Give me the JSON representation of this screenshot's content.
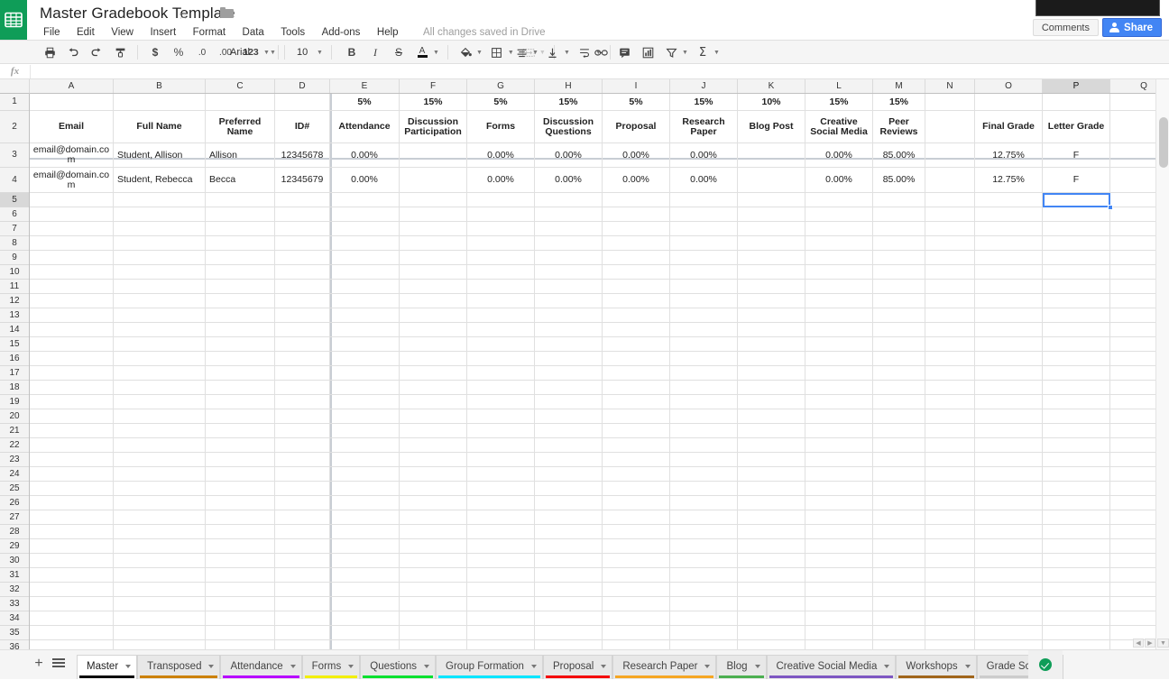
{
  "app": {
    "logo_icon": "sheets-grid-icon",
    "title": "Master Gradebook Template",
    "star_icon": "star-outline-icon",
    "folder_icon": "folder-icon",
    "save_status": "All changes saved in Drive",
    "accent_color": "#0f9d58",
    "share_color": "#4285f4"
  },
  "menu": {
    "items": [
      {
        "label": "File"
      },
      {
        "label": "Edit"
      },
      {
        "label": "View"
      },
      {
        "label": "Insert"
      },
      {
        "label": "Format"
      },
      {
        "label": "Data"
      },
      {
        "label": "Tools"
      },
      {
        "label": "Add-ons"
      },
      {
        "label": "Help"
      }
    ]
  },
  "header_actions": {
    "comments_label": "Comments",
    "share_label": "Share",
    "share_icon": "person-add-icon"
  },
  "toolbar": {
    "print_icon": "print-icon",
    "undo_icon": "undo-arrow-icon",
    "redo_icon": "redo-arrow-icon",
    "paint_format_icon": "paint-format-icon",
    "currency_icon": "$",
    "percent_icon": "%",
    "decrease_decimal_icon": ".0",
    "increase_decimal_icon": ".00",
    "more_formats_label": "123",
    "font_family": "Arial",
    "font_size": "10",
    "bold_icon": "B",
    "italic_icon": "I",
    "strikethrough_icon": "S",
    "text_color_icon": "A",
    "fill_color_icon": "fill-bucket-icon",
    "borders_icon": "borders-icon",
    "merge_cells_icon": "merge-cells-icon",
    "horizontal_align_icon": "horizontal-align-icon",
    "vertical_align_icon": "vertical-align-icon",
    "text_wrap_icon": "text-wrap-icon",
    "insert_link_icon": "link-icon",
    "insert_comment_icon": "comment-icon",
    "insert_chart_icon": "chart-icon",
    "filter_icon": "filter-funnel-icon",
    "functions_icon": "sigma-icon"
  },
  "formula_bar": {
    "fx_label": "fx",
    "value": "",
    "placeholder": ""
  },
  "spreadsheet": {
    "selected_cell": "P5",
    "selected_column": "P",
    "selected_row": "5",
    "frozen_columns": 4,
    "frozen_rows": 2,
    "columns": [
      {
        "letter": "A",
        "width": 93
      },
      {
        "letter": "B",
        "width": 102
      },
      {
        "letter": "C",
        "width": 77
      },
      {
        "letter": "D",
        "width": 61
      },
      {
        "letter": "E",
        "width": 77
      },
      {
        "letter": "F",
        "width": 75
      },
      {
        "letter": "G",
        "width": 75
      },
      {
        "letter": "H",
        "width": 75
      },
      {
        "letter": "I",
        "width": 75
      },
      {
        "letter": "J",
        "width": 75
      },
      {
        "letter": "K",
        "width": 75
      },
      {
        "letter": "L",
        "width": 75
      },
      {
        "letter": "M",
        "width": 58
      },
      {
        "letter": "N",
        "width": 55
      },
      {
        "letter": "O",
        "width": 75
      },
      {
        "letter": "P",
        "width": 75
      },
      {
        "letter": "Q",
        "width": 75
      }
    ],
    "row_numbers": [
      "1",
      "2",
      "3",
      "4",
      "5",
      "6",
      "7",
      "8",
      "9",
      "10",
      "11",
      "12",
      "13",
      "14",
      "15",
      "16",
      "17",
      "18",
      "19",
      "20",
      "21",
      "22",
      "23",
      "24",
      "25",
      "26",
      "27",
      "28",
      "29",
      "30",
      "31",
      "32",
      "33",
      "34",
      "35",
      "36"
    ],
    "weights_row": {
      "A": "",
      "B": "",
      "C": "",
      "D": "",
      "E": "5%",
      "F": "15%",
      "G": "5%",
      "H": "15%",
      "I": "5%",
      "J": "15%",
      "K": "10%",
      "L": "15%",
      "M": "15%",
      "N": "",
      "O": "",
      "P": "",
      "Q": ""
    },
    "header_row": {
      "A": "Email",
      "B": "Full Name",
      "C": "Preferred Name",
      "D": "ID#",
      "E": "Attendance",
      "F": "Discussion Participation",
      "G": "Forms",
      "H": "Discussion Questions",
      "I": "Proposal",
      "J": "Research Paper",
      "K": "Blog Post",
      "L": "Creative Social Media",
      "M": "Peer Reviews",
      "N": "",
      "O": "Final Grade",
      "P": "Letter Grade",
      "Q": ""
    },
    "data_rows": [
      {
        "row": "3",
        "A": "email@domain.com",
        "B": "Student, Allison",
        "C": "Allison",
        "D": "12345678",
        "E": "0.00%",
        "F": "",
        "G": "0.00%",
        "H": "0.00%",
        "I": "0.00%",
        "J": "0.00%",
        "K": "",
        "L": "0.00%",
        "M": "85.00%",
        "N": "",
        "O": "12.75%",
        "P": "F",
        "Q": ""
      },
      {
        "row": "4",
        "A": "email@domain.com",
        "B": "Student, Rebecca",
        "C": "Becca",
        "D": "12345679",
        "E": "0.00%",
        "F": "",
        "G": "0.00%",
        "H": "0.00%",
        "I": "0.00%",
        "J": "0.00%",
        "K": "",
        "L": "0.00%",
        "M": "85.00%",
        "N": "",
        "O": "12.75%",
        "P": "F",
        "Q": ""
      }
    ]
  },
  "sheet_tabs": {
    "add_sheet_icon": "plus-icon",
    "all_sheets_icon": "list-icon",
    "sync_icon": "check-circle-icon",
    "tabs": [
      {
        "label": "Master",
        "color": "#000000",
        "active": true
      },
      {
        "label": "Transposed",
        "color": "#cc8100",
        "active": false
      },
      {
        "label": "Attendance",
        "color": "#b700ff",
        "active": false
      },
      {
        "label": "Forms",
        "color": "#f2ef00",
        "active": false
      },
      {
        "label": "Questions",
        "color": "#00e02e",
        "active": false
      },
      {
        "label": "Group Formation",
        "color": "#00e5ff",
        "active": false
      },
      {
        "label": "Proposal",
        "color": "#f40000",
        "active": false
      },
      {
        "label": "Research Paper",
        "color": "#f5a623",
        "active": false
      },
      {
        "label": "Blog",
        "color": "#4caf50",
        "active": false
      },
      {
        "label": "Creative Social Media",
        "color": "#7e57c2",
        "active": false
      },
      {
        "label": "Workshops",
        "color": "#a0651a",
        "active": false
      },
      {
        "label": "Grade Scale",
        "color": "#cccccc",
        "active": false
      }
    ]
  }
}
